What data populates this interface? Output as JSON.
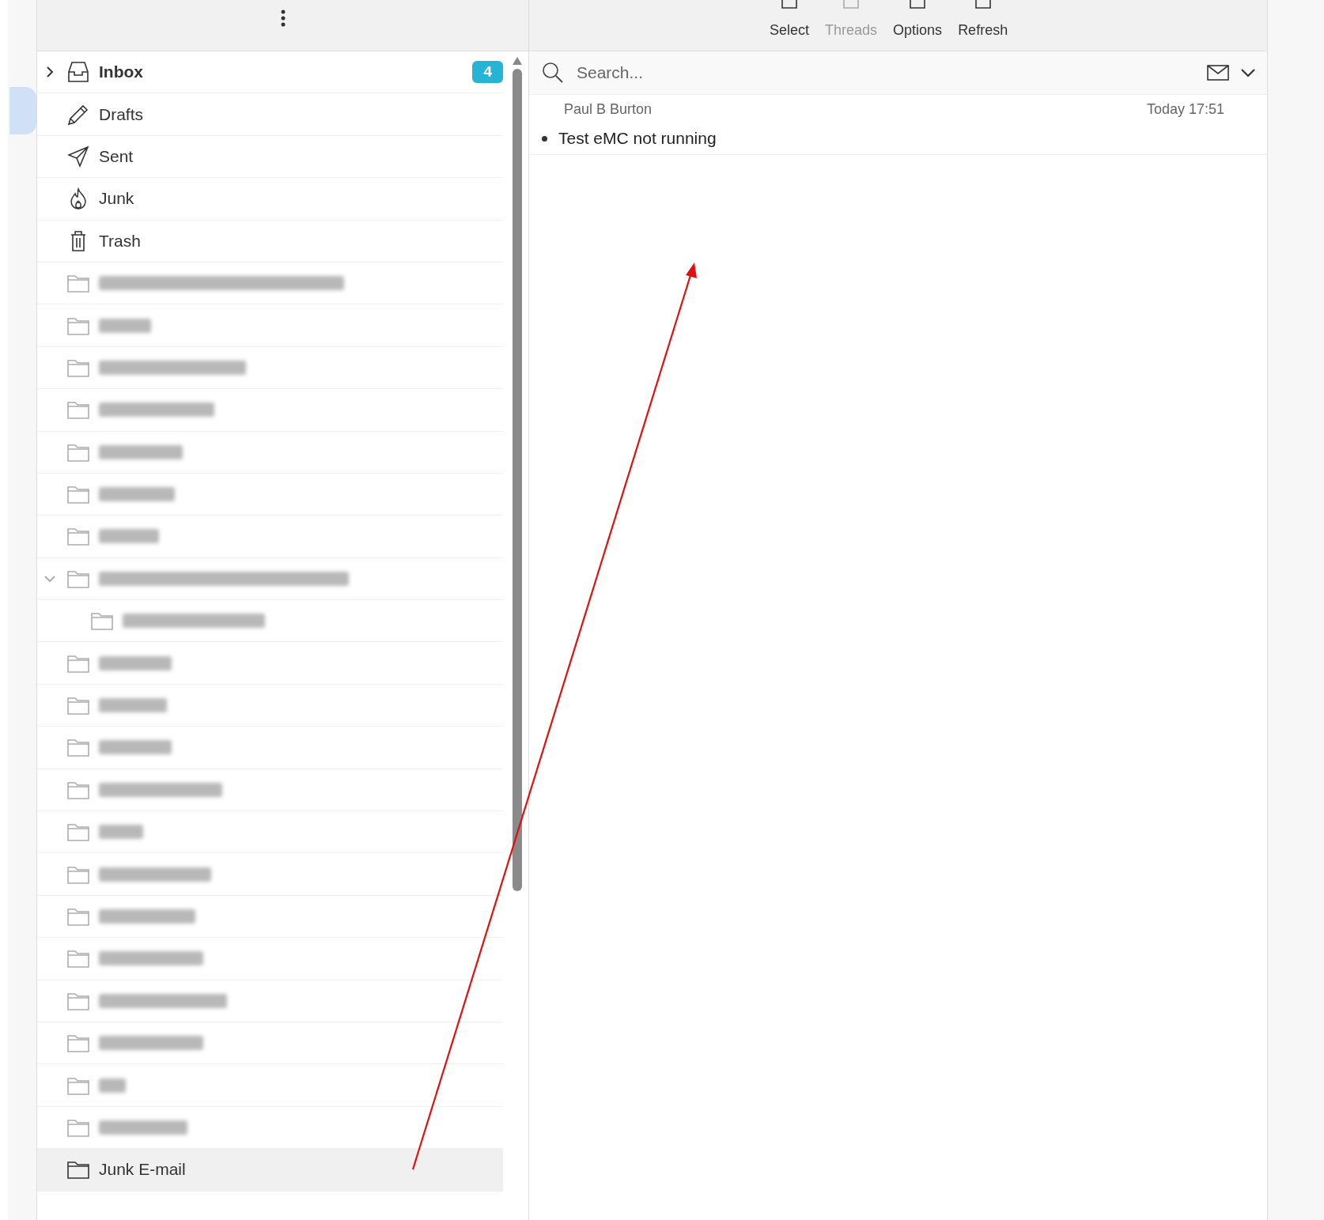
{
  "toolbar": {
    "buttons": [
      {
        "label": "Select",
        "disabled": false
      },
      {
        "label": "Threads",
        "disabled": true
      },
      {
        "label": "Options",
        "disabled": false
      },
      {
        "label": "Refresh",
        "disabled": false
      }
    ]
  },
  "folders": [
    {
      "kind": "inbox",
      "label": "Inbox",
      "badge": "4",
      "expanded": false,
      "selected": false
    },
    {
      "kind": "drafts",
      "label": "Drafts",
      "selected": false
    },
    {
      "kind": "sent",
      "label": "Sent",
      "selected": false
    },
    {
      "kind": "junk",
      "label": "Junk",
      "selected": false
    },
    {
      "kind": "trash",
      "label": "Trash",
      "selected": false
    },
    {
      "kind": "redacted",
      "selected": false
    },
    {
      "kind": "redacted",
      "selected": false
    },
    {
      "kind": "redacted",
      "selected": false
    },
    {
      "kind": "redacted",
      "selected": false
    },
    {
      "kind": "redacted",
      "selected": false
    },
    {
      "kind": "redacted",
      "selected": false
    },
    {
      "kind": "redacted",
      "selected": false
    },
    {
      "kind": "redacted",
      "selected": false,
      "expanded": true,
      "children": [
        {
          "kind": "redacted",
          "selected": false
        }
      ]
    },
    {
      "kind": "redacted",
      "selected": false
    },
    {
      "kind": "redacted",
      "selected": false
    },
    {
      "kind": "redacted",
      "selected": false
    },
    {
      "kind": "redacted",
      "selected": false
    },
    {
      "kind": "redacted",
      "selected": false
    },
    {
      "kind": "redacted",
      "selected": false
    },
    {
      "kind": "redacted",
      "selected": false
    },
    {
      "kind": "redacted",
      "selected": false
    },
    {
      "kind": "redacted",
      "selected": false
    },
    {
      "kind": "redacted",
      "selected": false
    },
    {
      "kind": "redacted",
      "selected": false
    },
    {
      "kind": "redacted",
      "selected": false
    },
    {
      "kind": "folder",
      "label": "Junk E-mail",
      "selected": true
    }
  ],
  "search": {
    "placeholder": "Search..."
  },
  "messages": [
    {
      "sender": "Paul B Burton",
      "time": "Today 17:51",
      "subject": "Test eMC not running",
      "unread": true
    }
  ]
}
